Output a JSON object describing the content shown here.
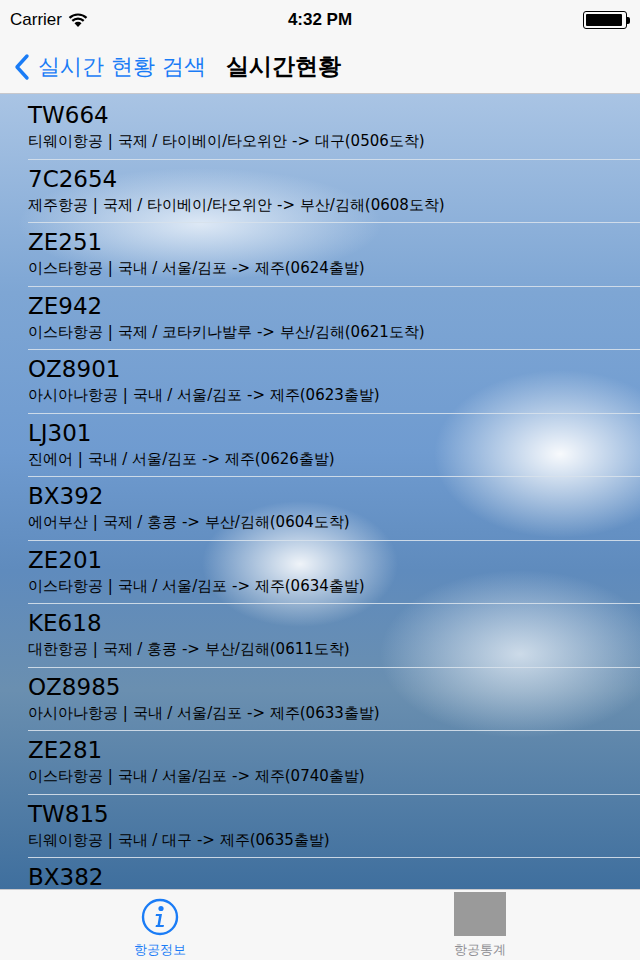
{
  "status_bar": {
    "carrier": "Carrier",
    "time": "4:32 PM",
    "battery": {
      "level": 0.95
    }
  },
  "nav_bar": {
    "back_label": "실시간 현황 검색",
    "title": "실시간현황"
  },
  "flights": [
    {
      "code": "TW664",
      "detail": "티웨이항공 | 국제 / 타이베이/타오위안 -> 대구(0506도착)"
    },
    {
      "code": "7C2654",
      "detail": "제주항공 | 국제 / 타이베이/타오위안 -> 부산/김해(0608도착)"
    },
    {
      "code": "ZE251",
      "detail": "이스타항공 | 국내 / 서울/김포 -> 제주(0624출발)"
    },
    {
      "code": "ZE942",
      "detail": "이스타항공 | 국제 / 코타키나발루 -> 부산/김해(0621도착)"
    },
    {
      "code": "OZ8901",
      "detail": "아시아나항공 | 국내 / 서울/김포 -> 제주(0623출발)"
    },
    {
      "code": "LJ301",
      "detail": "진에어 | 국내 / 서울/김포 -> 제주(0626출발)"
    },
    {
      "code": "BX392",
      "detail": "에어부산 | 국제 / 홍콩 -> 부산/김해(0604도착)"
    },
    {
      "code": "ZE201",
      "detail": "이스타항공 | 국내 / 서울/김포 -> 제주(0634출발)"
    },
    {
      "code": "KE618",
      "detail": "대한항공 | 국제 / 홍콩 -> 부산/김해(0611도착)"
    },
    {
      "code": "OZ8985",
      "detail": "아시아나항공 | 국내 / 서울/김포 -> 제주(0633출발)"
    },
    {
      "code": "ZE281",
      "detail": "이스타항공 | 국내 / 서울/김포 -> 제주(0740출발)"
    },
    {
      "code": "TW815",
      "detail": "티웨이항공 | 국내 / 대구 -> 제주(0635출발)"
    },
    {
      "code": "BX382",
      "detail": ""
    }
  ],
  "tab_bar": {
    "tabs": [
      {
        "label": "항공정보",
        "selected": true
      },
      {
        "label": "항공통계",
        "selected": false
      }
    ]
  }
}
